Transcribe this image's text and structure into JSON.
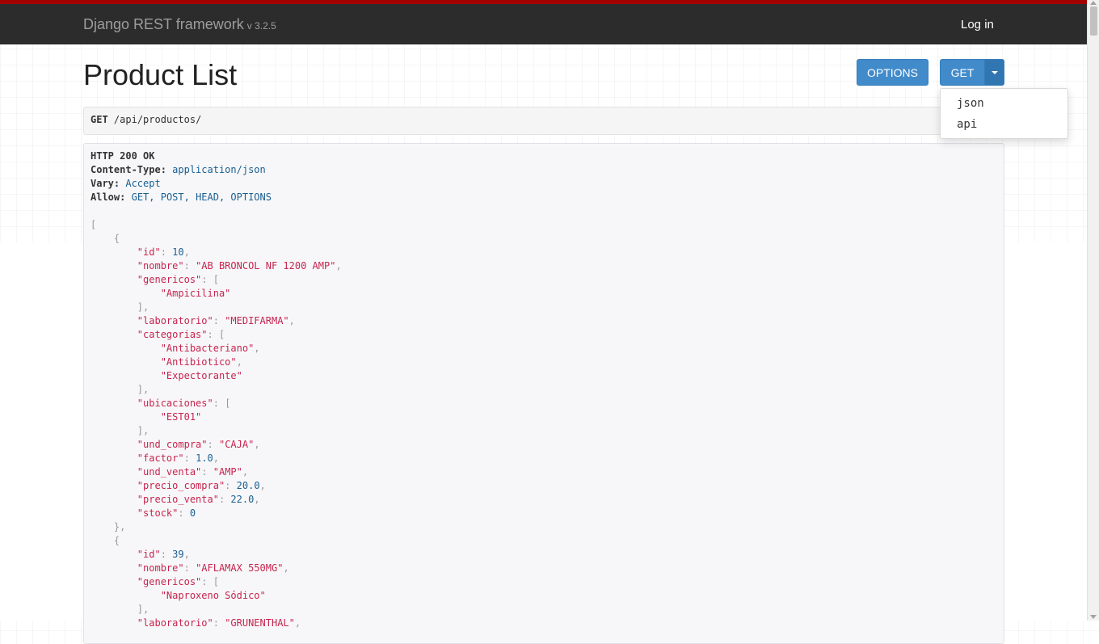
{
  "navbar": {
    "brand": "Django REST framework",
    "version": "v 3.2.5",
    "login_label": "Log in"
  },
  "page": {
    "title": "Product List"
  },
  "buttons": {
    "options_label": "OPTIONS",
    "get_label": "GET"
  },
  "dropdown": {
    "items": [
      "json",
      "api"
    ]
  },
  "request": {
    "method": "GET",
    "path": "/api/productos/"
  },
  "response": {
    "status": "HTTP 200 OK",
    "headers": [
      {
        "name": "Content-Type:",
        "value": "application/json"
      },
      {
        "name": "Vary:",
        "value": "Accept"
      },
      {
        "name": "Allow:",
        "value": "GET, POST, HEAD, OPTIONS"
      }
    ],
    "lines": [
      "[",
      "    {",
      "        \"id\": 10,",
      "        \"nombre\": \"AB BRONCOL NF 1200 AMP\",",
      "        \"genericos\": [",
      "            \"Ampicilina\"",
      "        ],",
      "        \"laboratorio\": \"MEDIFARMA\",",
      "        \"categorias\": [",
      "            \"Antibacteriano\",",
      "            \"Antibiotico\",",
      "            \"Expectorante\"",
      "        ],",
      "        \"ubicaciones\": [",
      "            \"EST01\"",
      "        ],",
      "        \"und_compra\": \"CAJA\",",
      "        \"factor\": 1.0,",
      "        \"und_venta\": \"AMP\",",
      "        \"precio_compra\": 20.0,",
      "        \"precio_venta\": 22.0,",
      "        \"stock\": 0",
      "    },",
      "    {",
      "        \"id\": 39,",
      "        \"nombre\": \"AFLAMAX 550MG\",",
      "        \"genericos\": [",
      "            \"Naproxeno Sódico\"",
      "        ],",
      "        \"laboratorio\": \"GRUNENTHAL\","
    ]
  },
  "colors": {
    "accent_bar": "#a30000",
    "navbar_bg": "#2c2c2c",
    "button_primary": "#428bca",
    "json_key": "#c7254e",
    "json_number": "#195f91"
  }
}
